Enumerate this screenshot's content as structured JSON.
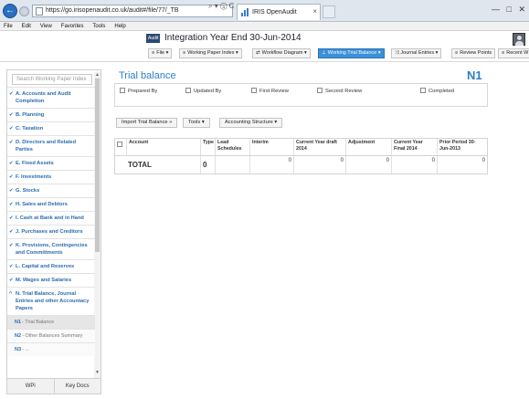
{
  "browser": {
    "url": "https://go.irisopenaudit.co.uk/audit#/file/77/_TB",
    "tab_title": "IRIS OpenAudit",
    "tab_close": "×",
    "addr_tools": "⌕ ▾ ⓐ C",
    "win_controls": [
      "—",
      "□",
      "✕"
    ]
  },
  "menu": [
    "File",
    "Edit",
    "View",
    "Favorites",
    "Tools",
    "Help"
  ],
  "header": {
    "badge": "Audit",
    "title": "Integration Year End 30-Jun-2014"
  },
  "toolbar": {
    "file": "File",
    "wp_index": "Working Paper Index",
    "workflow": "Workflow Diagram",
    "trial_balance": "Working Trial Balance",
    "journal": "Journal Entries",
    "review": "Review Points",
    "recent": "Recent W"
  },
  "sidebar": {
    "search_placeholder": "Search Working Paper Index",
    "items": [
      "A. Accounts and Audit Completion",
      "B. Planning",
      "C. Taxation",
      "D. Directors and Related Parties",
      "E. Fixed Assets",
      "F. Investments",
      "G. Stocks",
      "H. Sales and Debtors",
      "I. Cash at Bank and in Hand",
      "J. Purchases and Creditors",
      "K. Provisions, Contingencies and Committments",
      "L. Capital and Reserves",
      "M. Wages and Salaries",
      "N. Trial Balance, Journal Entries and other Accountacy Papers"
    ],
    "subitems": [
      {
        "code": "N1",
        "label": "- Trial Balance"
      },
      {
        "code": "N2",
        "label": "- Other Balances Summary"
      },
      {
        "code": "N3",
        "label": "- ..."
      }
    ],
    "tab_wp": "WPi",
    "tab_keydocs": "Key Docs"
  },
  "main": {
    "title": "Trial balance",
    "code": "N1",
    "signoff": {
      "prepared": "Prepared By",
      "updated": "Updated By",
      "first_review": "First Review",
      "second_review": "Second Review",
      "completed": "Completed"
    },
    "buttons": {
      "import": "Import Trial Balance »",
      "tools": "Tools ▾",
      "structure": "Accounting Structure ▾"
    },
    "table": {
      "headers": [
        "Account",
        "Type",
        "Lead Schedules",
        "Interim",
        "Current Year draft 2014",
        "Adjustment",
        "Current Year Final 2014",
        "Prior Period 30-Jun-2013"
      ],
      "total_row": {
        "label": "TOTAL",
        "type": "0",
        "lead": "",
        "interim": "0",
        "cy_draft": "0",
        "adjustment": "0",
        "cy_final": "0",
        "prior": "0"
      }
    }
  }
}
